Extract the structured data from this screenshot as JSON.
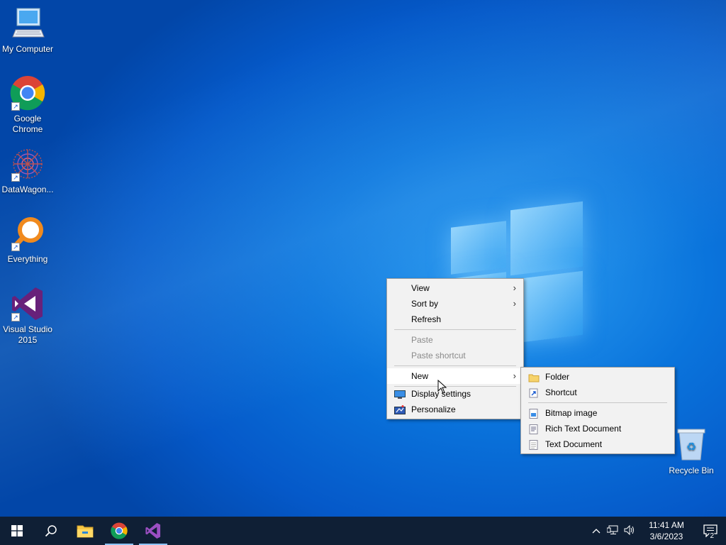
{
  "desktop": {
    "icons": [
      {
        "label": "My Computer",
        "icon": "computer-icon"
      },
      {
        "label": "Google Chrome",
        "icon": "chrome-icon"
      },
      {
        "label": "DataWagon...",
        "icon": "datawagon-icon"
      },
      {
        "label": "Everything",
        "icon": "everything-search-icon"
      },
      {
        "label": "Visual Studio 2015",
        "icon": "visual-studio-icon"
      },
      {
        "label": "Recycle Bin",
        "icon": "recycle-bin-icon"
      }
    ]
  },
  "context_menu": {
    "items": {
      "view": "View",
      "sort_by": "Sort by",
      "refresh": "Refresh",
      "paste": "Paste",
      "paste_shortcut": "Paste shortcut",
      "new": "New",
      "display_settings": "Display settings",
      "personalize": "Personalize"
    },
    "chevron": "›"
  },
  "new_submenu": {
    "items": {
      "folder": "Folder",
      "shortcut": "Shortcut",
      "bitmap_image": "Bitmap image",
      "rich_text_document": "Rich Text Document",
      "text_document": "Text Document"
    }
  },
  "taskbar": {
    "pinned": [
      "start-icon",
      "search-icon",
      "file-explorer-icon",
      "chrome-icon",
      "visual-studio-icon"
    ],
    "clock": {
      "time": "11:41 AM",
      "date": "3/6/2023"
    },
    "notification_count": "2"
  },
  "colors": {
    "taskbar_bg": "#0f1f35",
    "menu_bg": "#f2f2f2",
    "desktop_blue": "#0a74dc"
  }
}
